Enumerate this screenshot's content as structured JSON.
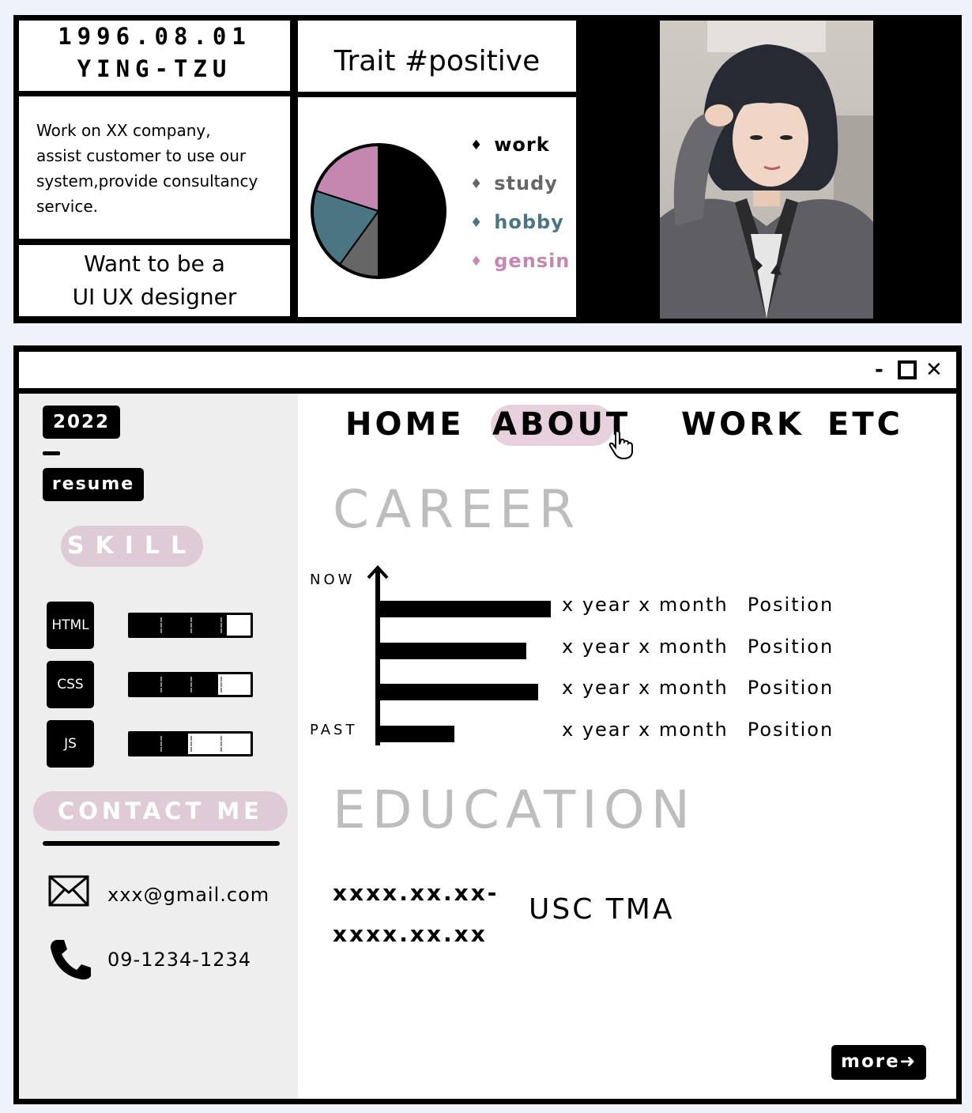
{
  "profile": {
    "birth_date": "1996.08.01",
    "name": "YING-TZU",
    "work_line1": "Work on XX company,",
    "work_line2": "assist customer to use our",
    "work_line3": "system,provide consultancy",
    "work_line4": "service.",
    "goal_line1": "Want to be a",
    "goal_line2": "UI UX designer"
  },
  "trait": {
    "title": "Trait #positive",
    "pie": [
      {
        "label": "work",
        "value": 50,
        "color": "#000000"
      },
      {
        "label": "study",
        "value": 10,
        "color": "#666666"
      },
      {
        "label": "hobby",
        "value": 20,
        "color": "#4a7583"
      },
      {
        "label": "gensin",
        "value": 20,
        "color": "#c387b0"
      }
    ],
    "legend_symbol": "♦"
  },
  "window": {
    "min_icon": "-",
    "max_icon": "□",
    "close_icon": "✕"
  },
  "sidebar": {
    "year": "2022",
    "resume": "resume",
    "skill_title": "SKILL",
    "skills": [
      {
        "name": "HTML",
        "level": 0.8
      },
      {
        "name": "CSS",
        "level": 0.73
      },
      {
        "name": "JS",
        "level": 0.48
      }
    ],
    "contact_title": "CONTACT ME",
    "email": "xxx@gmail.com",
    "phone": "09-1234-1234"
  },
  "nav": {
    "items": [
      "HOME",
      "ABOUT",
      "WORK",
      "ETC"
    ],
    "active": "ABOUT"
  },
  "career": {
    "title": "CAREER",
    "top_label": "NOW",
    "bottom_label": "PAST",
    "rows": [
      {
        "duration": "x year x month",
        "position": "Position",
        "length": 1.0
      },
      {
        "duration": "x year x month",
        "position": "Position",
        "length": 0.86
      },
      {
        "duration": "x year x month",
        "position": "Position",
        "length": 0.93
      },
      {
        "duration": "x year x month",
        "position": "Position",
        "length": 0.45
      }
    ]
  },
  "education": {
    "title": "EDUCATION",
    "date_line1": "xxxx.xx.xx-",
    "date_line2": "xxxx.xx.xx",
    "school": "USC TMA"
  },
  "more_button": "more➜"
}
